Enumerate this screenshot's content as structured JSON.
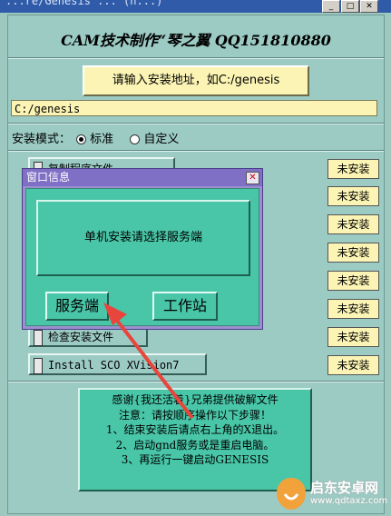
{
  "window": {
    "title_fragment": "...re/Genesis ... (n...)"
  },
  "header": {
    "title": "CAM技术制作“琴之翼 QQ151810880"
  },
  "install": {
    "prompt_label": "请输入安装地址，如C:/genesis",
    "path_value": "C:/genesis",
    "mode_label": "安装模式：",
    "mode_options": [
      "标准",
      "自定义"
    ],
    "mode_selected": "标准"
  },
  "steps": [
    {
      "label": "复制程序文件",
      "status": "未安装"
    },
    {
      "label": "",
      "status": "未安装"
    },
    {
      "label": "",
      "status": "未安装"
    },
    {
      "label": "",
      "status": "未安装"
    },
    {
      "label": "",
      "status": "未安装"
    },
    {
      "label": "",
      "status": "未安装"
    },
    {
      "label": "检查安装文件",
      "status": "未安装"
    },
    {
      "label": "Install SCO XVision7",
      "status": "未安装"
    }
  ],
  "dialog": {
    "title": "窗口信息",
    "message": "单机安装请选择服务端",
    "server_button": "服务端",
    "workstation_button": "工作站"
  },
  "thanks_box": {
    "lines": [
      "感谢{我还活着}兄弟提供破解文件",
      "注意：请按顺序操作以下步骤！",
      "1、结束安装后请点右上角的X退出。",
      "2、启动gnd服务或是重启电脑。",
      "3、再运行一键启动GENESIS"
    ]
  },
  "watermark": {
    "name": "启东安卓网",
    "url": "www.qdtaxz.com"
  },
  "colors": {
    "panel": "#9ccbc4",
    "teal": "#49c6a8",
    "yellow": "#fbf4b4",
    "dialog": "#9b8fd0",
    "arrow": "#e8453c"
  }
}
